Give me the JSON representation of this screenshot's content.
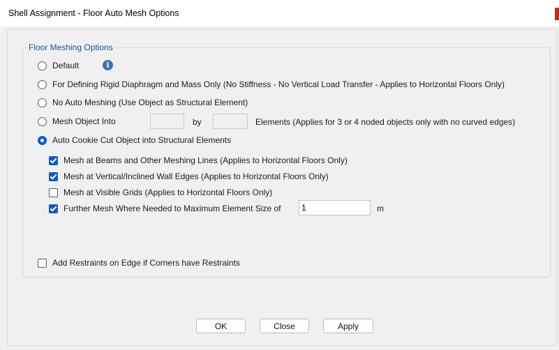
{
  "window": {
    "title": "Shell Assignment - Floor Auto Mesh Options"
  },
  "group": {
    "title": "Floor Meshing Options",
    "options": [
      {
        "label": "Default",
        "selected": false
      },
      {
        "label": "For Defining Rigid Diaphragm and Mass Only  (No Stiffness - No Vertical Load Transfer - Applies to Horizontal Floors Only)",
        "selected": false
      },
      {
        "label": "No Auto Meshing  (Use Object as Structural Element)",
        "selected": false
      },
      {
        "label": "Mesh Object Into",
        "selected": false
      },
      {
        "label": "Auto Cookie Cut Object into Structural Elements",
        "selected": true
      }
    ],
    "mesh_into": {
      "value1": "",
      "by_label": "by",
      "value2": "",
      "suffix": "Elements (Applies for 3 or 4 noded objects only with no curved edges)"
    },
    "suboptions": [
      {
        "label": "Mesh at Beams and Other Meshing Lines  (Applies to Horizontal Floors Only)",
        "checked": true
      },
      {
        "label": "Mesh at Vertical/Inclined Wall Edges  (Applies to Horizontal Floors Only)",
        "checked": true
      },
      {
        "label": "Mesh at Visible Grids  (Applies to Horizontal Floors Only)",
        "checked": false
      },
      {
        "label": "Further Mesh Where Needed to Maximum Element Size of",
        "checked": true
      }
    ],
    "max_element_size": {
      "value": "1",
      "unit": "m"
    },
    "restraints": {
      "label": "Add Restraints on Edge if Corners have Restraints",
      "checked": false
    }
  },
  "buttons": {
    "ok": "OK",
    "close": "Close",
    "apply": "Apply"
  },
  "icons": {
    "info": "info-icon"
  },
  "colors": {
    "accent": "#0b5cc5",
    "group_title": "#1f4f8f",
    "close_edge": "#c42b1c"
  }
}
